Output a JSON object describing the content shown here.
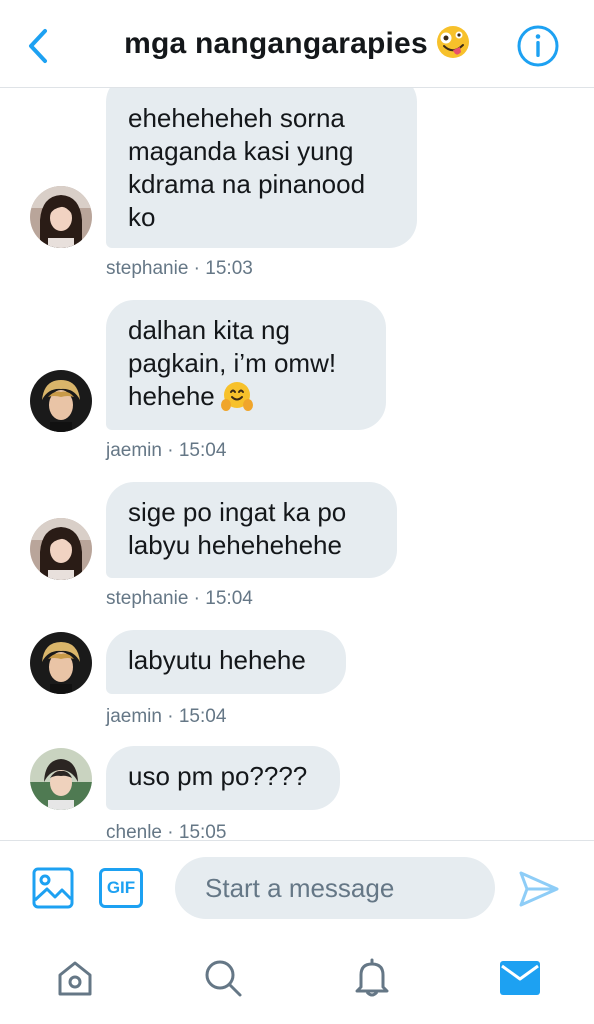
{
  "header": {
    "title": "mga nangangarapies",
    "title_emoji_icon": "zany-face-emoji-icon",
    "back_icon": "chevron-left-icon",
    "info_icon": "info-circle-icon"
  },
  "messages": [
    {
      "sender": "stephanie",
      "time": "15:03",
      "meta": "stephanie · 15:03",
      "lines": [
        "eheheheheh sorna",
        "maganda kasi yung",
        "kdrama na pinanood",
        "ko"
      ]
    },
    {
      "sender": "jaemin",
      "time": "15:04",
      "meta": "jaemin · 15:04",
      "lines": [
        "dalhan kita ng",
        "pagkain, i’m omw!",
        "hehehe"
      ],
      "emoji_icon": "hugging-face-emoji-icon"
    },
    {
      "sender": "stephanie",
      "time": "15:04",
      "meta": "stephanie · 15:04",
      "lines": [
        "sige po ingat ka po",
        "labyu hehehehehe"
      ]
    },
    {
      "sender": "jaemin",
      "time": "15:04",
      "meta": "jaemin · 15:04",
      "lines": [
        "labyutu hehehe"
      ]
    },
    {
      "sender": "chenle",
      "time": "15:05",
      "meta": "chenle · 15:05",
      "lines": [
        "uso pm po????"
      ]
    }
  ],
  "composer": {
    "placeholder": "Start a message",
    "gif_label": "GIF",
    "media_icon": "image-icon",
    "send_icon": "send-icon"
  },
  "tabbar": {
    "items": [
      "home-icon",
      "search-icon",
      "notifications-bell-icon",
      "messages-envelope-icon"
    ],
    "active": "messages-envelope-icon"
  },
  "colors": {
    "accent": "#1da1f2",
    "bubble": "#e6ecf0",
    "meta_text": "#657786",
    "tab_inactive": "#657786",
    "divider": "#dfe3e7"
  }
}
